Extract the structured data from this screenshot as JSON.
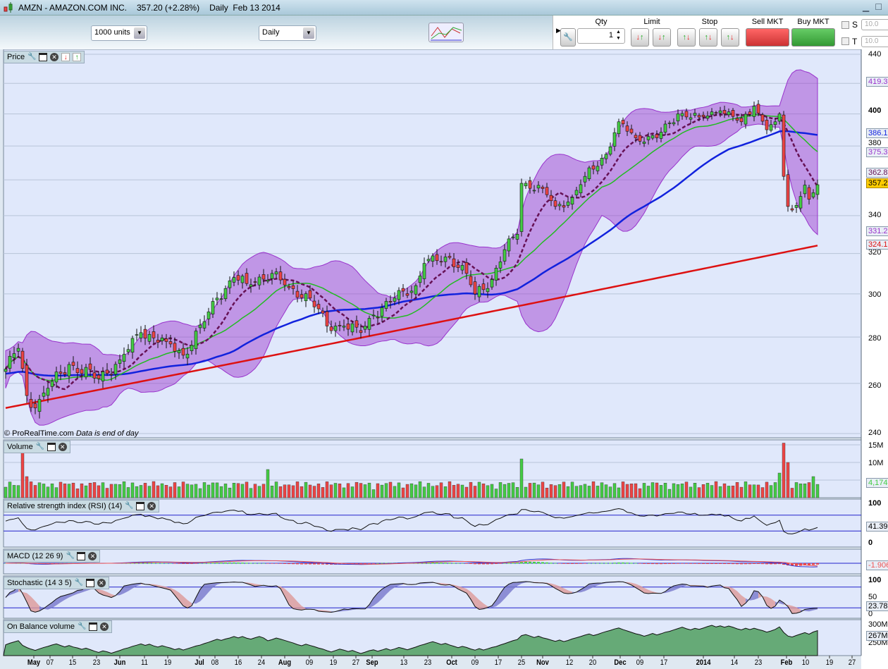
{
  "window": {
    "symbol": "AMZN - AMAZON.COM INC.",
    "price": "357.20 (+2.28%)",
    "period": "Daily",
    "date": "Feb 13 2014"
  },
  "toolbar": {
    "units": "1000 units",
    "timeframe": "Daily",
    "qty_label": "Qty",
    "qty": "1",
    "limit_label": "Limit",
    "stop_label": "Stop",
    "sell_label": "Sell MKT",
    "buy_label": "Buy MKT",
    "s_label": "S",
    "t_label": "T",
    "s_value": "10.0",
    "t_value": "10.0"
  },
  "panels": {
    "price": "Price",
    "volume": "Volume",
    "rsi": "Relative strength index (RSI) (14)",
    "macd": "MACD (12 26 9)",
    "stoch": "Stochastic (14 3 5)",
    "obv": "On Balance volume"
  },
  "copyright": "© ProRealTime.com",
  "copyright_note": "Data is end of day",
  "axis": {
    "price_ticks": [
      "440",
      "400",
      "380",
      "340",
      "320",
      "300",
      "280",
      "260",
      "240"
    ],
    "volume_ticks": [
      "15M",
      "10M"
    ],
    "rsi_ticks": [
      "100",
      "0"
    ],
    "stoch_ticks": [
      "100",
      "50",
      "0"
    ],
    "obv_ticks": [
      "300M",
      "250M"
    ]
  },
  "last_values": {
    "bb_upper": "419.3",
    "ma50": "386.1",
    "ma20": "375.3",
    "ma10": "362.8",
    "close": "357.2",
    "bb_lower": "331.2",
    "ma200": "324.1",
    "volume": "4,174",
    "rsi": "41.39",
    "macd": "-1.906",
    "stoch": "23.78",
    "obv": "267M"
  },
  "colors": {
    "up": "#44cc44",
    "down": "#ee4444",
    "bb": "#9933cc",
    "ma20": "#22bb22",
    "ma50": "#1122dd",
    "ma200": "#dd1111",
    "ma10": "#661155",
    "obv": "#66aa77"
  },
  "chart_data": {
    "type": "candlestick",
    "title": "AMZN - AMAZON.COM INC. Daily",
    "x_labels": [
      "May",
      "07",
      "15",
      "23",
      "Jun",
      "11",
      "19",
      "Jul",
      "08",
      "16",
      "24",
      "Aug",
      "09",
      "19",
      "27",
      "Sep",
      "13",
      "23",
      "Oct",
      "09",
      "17",
      "25",
      "Nov",
      "12",
      "20",
      "Dec",
      "09",
      "17",
      "2014",
      "14",
      "23",
      "Feb",
      "10",
      "19",
      "27"
    ],
    "scale": "log",
    "ylim": [
      240,
      440
    ],
    "close_keypoints": [
      [
        0,
        266
      ],
      [
        3,
        275
      ],
      [
        5,
        255
      ],
      [
        7,
        250
      ],
      [
        10,
        258
      ],
      [
        15,
        268
      ],
      [
        22,
        262
      ],
      [
        27,
        270
      ],
      [
        32,
        282
      ],
      [
        38,
        278
      ],
      [
        42,
        272
      ],
      [
        47,
        287
      ],
      [
        50,
        298
      ],
      [
        54,
        308
      ],
      [
        57,
        305
      ],
      [
        63,
        310
      ],
      [
        67,
        303
      ],
      [
        72,
        298
      ],
      [
        76,
        285
      ],
      [
        80,
        285
      ],
      [
        84,
        282
      ],
      [
        87,
        290
      ],
      [
        92,
        298
      ],
      [
        97,
        304
      ],
      [
        99,
        315
      ],
      [
        105,
        318
      ],
      [
        109,
        310
      ],
      [
        111,
        300
      ],
      [
        115,
        307
      ],
      [
        118,
        322
      ],
      [
        121,
        330
      ],
      [
        122,
        358
      ],
      [
        127,
        355
      ],
      [
        130,
        345
      ],
      [
        134,
        350
      ],
      [
        137,
        362
      ],
      [
        142,
        375
      ],
      [
        145,
        395
      ],
      [
        149,
        385
      ],
      [
        154,
        385
      ],
      [
        159,
        400
      ],
      [
        164,
        398
      ],
      [
        169,
        402
      ],
      [
        174,
        395
      ],
      [
        177,
        405
      ],
      [
        180,
        390
      ],
      [
        182,
        395
      ],
      [
        183,
        400
      ],
      [
        184,
        362
      ],
      [
        185,
        345
      ],
      [
        186,
        343
      ],
      [
        189,
        357
      ],
      [
        190,
        349
      ],
      [
        192,
        357.2
      ]
    ],
    "ma200_endpoints": [
      250,
      324.1
    ],
    "volume_spikes_m": [
      [
        4,
        13
      ],
      [
        5,
        6
      ],
      [
        62,
        8
      ],
      [
        122,
        11
      ],
      [
        183,
        7
      ],
      [
        184,
        15.5
      ],
      [
        185,
        10
      ],
      [
        191,
        6
      ]
    ]
  }
}
